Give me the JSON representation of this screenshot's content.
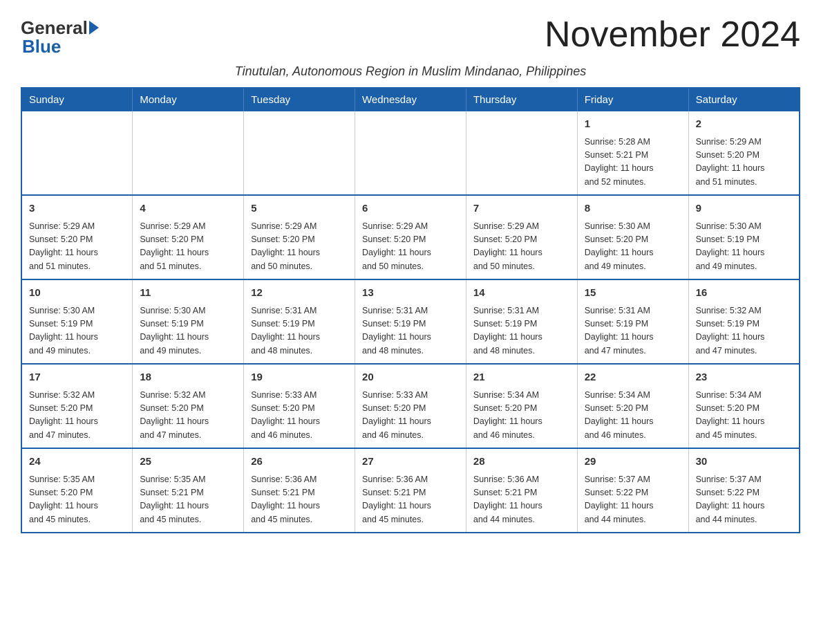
{
  "logo": {
    "general": "General",
    "blue": "Blue"
  },
  "title": "November 2024",
  "subtitle": "Tinutulan, Autonomous Region in Muslim Mindanao, Philippines",
  "days_of_week": [
    "Sunday",
    "Monday",
    "Tuesday",
    "Wednesday",
    "Thursday",
    "Friday",
    "Saturday"
  ],
  "weeks": [
    [
      {
        "day": "",
        "info": ""
      },
      {
        "day": "",
        "info": ""
      },
      {
        "day": "",
        "info": ""
      },
      {
        "day": "",
        "info": ""
      },
      {
        "day": "",
        "info": ""
      },
      {
        "day": "1",
        "info": "Sunrise: 5:28 AM\nSunset: 5:21 PM\nDaylight: 11 hours\nand 52 minutes."
      },
      {
        "day": "2",
        "info": "Sunrise: 5:29 AM\nSunset: 5:20 PM\nDaylight: 11 hours\nand 51 minutes."
      }
    ],
    [
      {
        "day": "3",
        "info": "Sunrise: 5:29 AM\nSunset: 5:20 PM\nDaylight: 11 hours\nand 51 minutes."
      },
      {
        "day": "4",
        "info": "Sunrise: 5:29 AM\nSunset: 5:20 PM\nDaylight: 11 hours\nand 51 minutes."
      },
      {
        "day": "5",
        "info": "Sunrise: 5:29 AM\nSunset: 5:20 PM\nDaylight: 11 hours\nand 50 minutes."
      },
      {
        "day": "6",
        "info": "Sunrise: 5:29 AM\nSunset: 5:20 PM\nDaylight: 11 hours\nand 50 minutes."
      },
      {
        "day": "7",
        "info": "Sunrise: 5:29 AM\nSunset: 5:20 PM\nDaylight: 11 hours\nand 50 minutes."
      },
      {
        "day": "8",
        "info": "Sunrise: 5:30 AM\nSunset: 5:20 PM\nDaylight: 11 hours\nand 49 minutes."
      },
      {
        "day": "9",
        "info": "Sunrise: 5:30 AM\nSunset: 5:19 PM\nDaylight: 11 hours\nand 49 minutes."
      }
    ],
    [
      {
        "day": "10",
        "info": "Sunrise: 5:30 AM\nSunset: 5:19 PM\nDaylight: 11 hours\nand 49 minutes."
      },
      {
        "day": "11",
        "info": "Sunrise: 5:30 AM\nSunset: 5:19 PM\nDaylight: 11 hours\nand 49 minutes."
      },
      {
        "day": "12",
        "info": "Sunrise: 5:31 AM\nSunset: 5:19 PM\nDaylight: 11 hours\nand 48 minutes."
      },
      {
        "day": "13",
        "info": "Sunrise: 5:31 AM\nSunset: 5:19 PM\nDaylight: 11 hours\nand 48 minutes."
      },
      {
        "day": "14",
        "info": "Sunrise: 5:31 AM\nSunset: 5:19 PM\nDaylight: 11 hours\nand 48 minutes."
      },
      {
        "day": "15",
        "info": "Sunrise: 5:31 AM\nSunset: 5:19 PM\nDaylight: 11 hours\nand 47 minutes."
      },
      {
        "day": "16",
        "info": "Sunrise: 5:32 AM\nSunset: 5:19 PM\nDaylight: 11 hours\nand 47 minutes."
      }
    ],
    [
      {
        "day": "17",
        "info": "Sunrise: 5:32 AM\nSunset: 5:20 PM\nDaylight: 11 hours\nand 47 minutes."
      },
      {
        "day": "18",
        "info": "Sunrise: 5:32 AM\nSunset: 5:20 PM\nDaylight: 11 hours\nand 47 minutes."
      },
      {
        "day": "19",
        "info": "Sunrise: 5:33 AM\nSunset: 5:20 PM\nDaylight: 11 hours\nand 46 minutes."
      },
      {
        "day": "20",
        "info": "Sunrise: 5:33 AM\nSunset: 5:20 PM\nDaylight: 11 hours\nand 46 minutes."
      },
      {
        "day": "21",
        "info": "Sunrise: 5:34 AM\nSunset: 5:20 PM\nDaylight: 11 hours\nand 46 minutes."
      },
      {
        "day": "22",
        "info": "Sunrise: 5:34 AM\nSunset: 5:20 PM\nDaylight: 11 hours\nand 46 minutes."
      },
      {
        "day": "23",
        "info": "Sunrise: 5:34 AM\nSunset: 5:20 PM\nDaylight: 11 hours\nand 45 minutes."
      }
    ],
    [
      {
        "day": "24",
        "info": "Sunrise: 5:35 AM\nSunset: 5:20 PM\nDaylight: 11 hours\nand 45 minutes."
      },
      {
        "day": "25",
        "info": "Sunrise: 5:35 AM\nSunset: 5:21 PM\nDaylight: 11 hours\nand 45 minutes."
      },
      {
        "day": "26",
        "info": "Sunrise: 5:36 AM\nSunset: 5:21 PM\nDaylight: 11 hours\nand 45 minutes."
      },
      {
        "day": "27",
        "info": "Sunrise: 5:36 AM\nSunset: 5:21 PM\nDaylight: 11 hours\nand 45 minutes."
      },
      {
        "day": "28",
        "info": "Sunrise: 5:36 AM\nSunset: 5:21 PM\nDaylight: 11 hours\nand 44 minutes."
      },
      {
        "day": "29",
        "info": "Sunrise: 5:37 AM\nSunset: 5:22 PM\nDaylight: 11 hours\nand 44 minutes."
      },
      {
        "day": "30",
        "info": "Sunrise: 5:37 AM\nSunset: 5:22 PM\nDaylight: 11 hours\nand 44 minutes."
      }
    ]
  ]
}
